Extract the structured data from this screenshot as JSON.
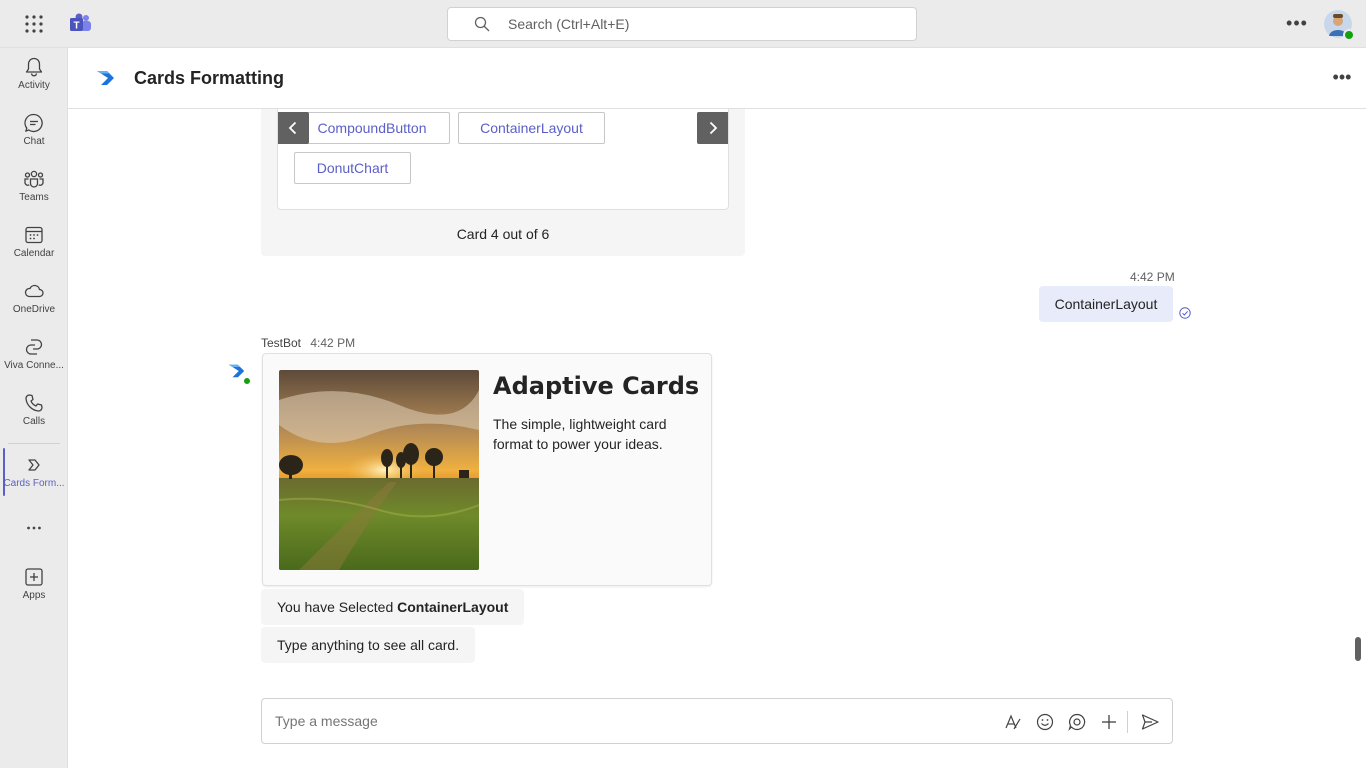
{
  "search": {
    "placeholder": "Search (Ctrl+Alt+E)"
  },
  "rail": {
    "items": [
      {
        "label": "Activity",
        "icon": "bell-icon"
      },
      {
        "label": "Chat",
        "icon": "chat-icon"
      },
      {
        "label": "Teams",
        "icon": "teams-icon"
      },
      {
        "label": "Calendar",
        "icon": "calendar-icon"
      },
      {
        "label": "OneDrive",
        "icon": "cloud-icon"
      },
      {
        "label": "Viva Conne...",
        "icon": "viva-connections-icon"
      },
      {
        "label": "Calls",
        "icon": "phone-icon"
      },
      {
        "label": "Cards Form...",
        "icon": "cards-formatting-icon"
      },
      {
        "label": "...",
        "icon": "more-apps-icon"
      },
      {
        "label": "Apps",
        "icon": "add-app-icon"
      }
    ]
  },
  "header": {
    "title": "Cards Formatting"
  },
  "carousel": {
    "chips": [
      "CompoundButton",
      "ContainerLayout",
      "DonutChart"
    ],
    "count_text": "Card 4 out of 6"
  },
  "sent": {
    "time": "4:42 PM",
    "text": "ContainerLayout"
  },
  "bot": {
    "name": "TestBot",
    "time": "4:42 PM",
    "card": {
      "title": "Adaptive Cards",
      "description": "The simple, lightweight card format to power your ideas."
    },
    "selected_prefix": "You have Selected ",
    "selected_value": "ContainerLayout",
    "hint": "Type anything to see all card."
  },
  "compose": {
    "placeholder": "Type a message"
  },
  "colors": {
    "accent": "#5b5fc7",
    "presence": "#13a10e",
    "rail_bg": "#ebebeb",
    "sent_bubble": "#e8ebfa"
  }
}
